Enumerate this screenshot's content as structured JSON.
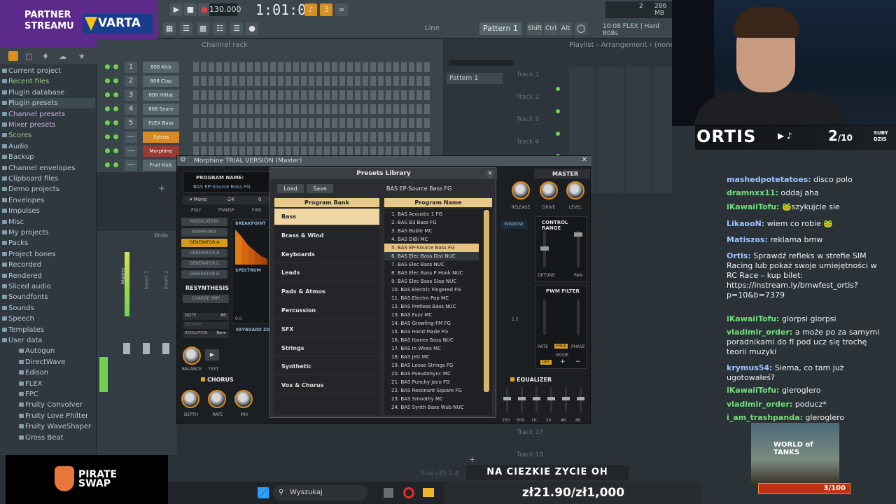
{
  "partner": {
    "line1": "PARTNER",
    "line2": "STREAMU",
    "brand": "VARTA"
  },
  "toolbar": {
    "tempo": "130.000",
    "time": "1:01:00",
    "line_mode": "Line",
    "pattern": "Pattern 1",
    "snap_keys": [
      "Shift",
      "Ctrl",
      "Alt"
    ],
    "hint": "10:08  FLEX | Hard 808s",
    "cpu": "286 MB",
    "cpu_n": "2"
  },
  "browser": {
    "items": [
      {
        "label": "Current project",
        "cls": ""
      },
      {
        "label": "Recent files",
        "cls": "green"
      },
      {
        "label": "Plugin database",
        "cls": ""
      },
      {
        "label": "Plugin presets",
        "cls": "hl"
      },
      {
        "label": "Channel presets",
        "cls": "purple"
      },
      {
        "label": "Mixer presets",
        "cls": "purple"
      },
      {
        "label": "Scores",
        "cls": "green"
      },
      {
        "label": "Audio",
        "cls": ""
      },
      {
        "label": "Backup",
        "cls": ""
      },
      {
        "label": "Channel envelopes",
        "cls": ""
      },
      {
        "label": "Clipboard files",
        "cls": ""
      },
      {
        "label": "Demo projects",
        "cls": ""
      },
      {
        "label": "Envelopes",
        "cls": ""
      },
      {
        "label": "Impulses",
        "cls": ""
      },
      {
        "label": "Misc",
        "cls": ""
      },
      {
        "label": "My projects",
        "cls": ""
      },
      {
        "label": "Packs",
        "cls": ""
      },
      {
        "label": "Project bones",
        "cls": ""
      },
      {
        "label": "Recorded",
        "cls": ""
      },
      {
        "label": "Rendered",
        "cls": ""
      },
      {
        "label": "Sliced audio",
        "cls": ""
      },
      {
        "label": "Soundfonts",
        "cls": ""
      },
      {
        "label": "Sounds",
        "cls": ""
      },
      {
        "label": "Speech",
        "cls": ""
      },
      {
        "label": "Templates",
        "cls": ""
      },
      {
        "label": "User data",
        "cls": ""
      },
      {
        "label": "Autogun",
        "cls": "sub"
      },
      {
        "label": "DirectWave",
        "cls": "sub"
      },
      {
        "label": "Edison",
        "cls": "sub"
      },
      {
        "label": "FLEX",
        "cls": "sub"
      },
      {
        "label": "FPC",
        "cls": "sub"
      },
      {
        "label": "Fruity Convolver",
        "cls": "sub"
      },
      {
        "label": "Fruity Love Philter",
        "cls": "sub"
      },
      {
        "label": "Fruity WaveShaper",
        "cls": "sub"
      },
      {
        "label": "Gross Beat",
        "cls": "sub"
      }
    ]
  },
  "channel_rack": {
    "title": "Channel rack",
    "channels": [
      {
        "num": "1",
        "name": "808 Kick",
        "cls": ""
      },
      {
        "num": "2",
        "name": "808 Clap",
        "cls": ""
      },
      {
        "num": "3",
        "name": "808 HiHat",
        "cls": ""
      },
      {
        "num": "4",
        "name": "808 Snare",
        "cls": ""
      },
      {
        "num": "5",
        "name": "FLEX Bass",
        "cls": ""
      },
      {
        "num": "---",
        "name": "Sytrus",
        "cls": "orange"
      },
      {
        "num": "---",
        "name": "Morphine",
        "cls": "red"
      },
      {
        "num": "---",
        "name": "Fruit Kick",
        "cls": ""
      }
    ]
  },
  "playlist": {
    "title": "Playlist - Arrangement › (none)",
    "pattern": "Pattern 1",
    "tracks": [
      "Track 1",
      "Track 2",
      "Track 3",
      "Track 4",
      "Track 17",
      "Track 18"
    ]
  },
  "mixer": {
    "wide": "Wide",
    "master": "Master",
    "insert1": "Insert 1",
    "insert2": "Insert 2"
  },
  "morphine": {
    "title": "Morphine TRIAL VERSION (Master)",
    "program_name_label": "PROGRAM NAME:",
    "program_name": "BAS EP-Source Bass FG",
    "mono": "Mono",
    "transp_val": "-24",
    "fine_val": "0",
    "poly": "POLY",
    "transp": "TRANSP",
    "fine": "FINE",
    "left_buttons": [
      "MODULATION",
      "MORPH/MIX",
      "GENERATOR A",
      "GENERATOR B",
      "GENERATOR C",
      "GENERATOR D"
    ],
    "breakpoint": "BREAKPOINT",
    "spectrum": "SPECTRUM",
    "keyboard_zone": "KEYBOARD ZO",
    "resynthesis": "RESYNTHESIS",
    "charge_smp": "CHARGE SMP",
    "note_lbl": "NOTE",
    "note_val": "60",
    "detune_lbl": "DETUNE",
    "resolution_lbl": "RESOLUTION",
    "resolution_val": "Norm",
    "balance": "BALANCE",
    "test": "TEST",
    "chorus": "CHORUS",
    "chorus_knobs": [
      "DEPTH",
      "RATE",
      "MIX"
    ],
    "master": "MASTER",
    "master_knobs": [
      "RELEASE",
      "DRIVE",
      "LEVEL"
    ],
    "control_range": "CONTROL RANGE",
    "detune_pan": [
      "DETUNE",
      "PAN"
    ],
    "pwm_filter": "PWM FILTER",
    "pwm_lbls": [
      "RATE",
      "FREE",
      "PHASE"
    ],
    "mode": "MODE",
    "mode_off": "OFF",
    "equalizer": "EQUALIZER",
    "eq_bands": [
      "250",
      "500",
      "1K",
      "2K",
      "4K",
      "8K"
    ],
    "window": "WINDOW",
    "val_00": "0.0",
    "val_15": "1.5"
  },
  "presets": {
    "title": "Presets Library",
    "load": "Load",
    "save": "Save",
    "current": "BAS EP-Source Bass FG",
    "bank_header": "Program Bank",
    "prog_header": "Program Name",
    "banks": [
      "Bass",
      "Brass & Wind",
      "Keyboards",
      "Leads",
      "Pads & Atmos",
      "Percussion",
      "SFX",
      "Strings",
      "Synthetic",
      "Vox & Chorus"
    ],
    "selected_bank": 0,
    "programs": [
      "1. BAS Acoustic 1 FG",
      "2. BAS B3 Bass FG",
      "3. BAS Buble MC",
      "4. BAS DiBi MC",
      "5. BAS EP-Source Bass FG",
      "6. BAS Elec Bass Dist NUC",
      "7. BAS Elec Bass NUC",
      "8. BAS Elec Bass P Hook NUC",
      "9. BAS Elec Bass Slap NUC",
      "10. BAS Electric Fingered FG",
      "11. BAS Electro Pop MC",
      "12. BAS Fretless Bass NUC",
      "13. BAS Fuzz MC",
      "14. BAS Growling-FM FG",
      "15. BAS Hand Made FG",
      "16. BAS Ibanez Bass NUC",
      "17. BAS In Wires MC",
      "18. BAS Jett MC",
      "19. BAS Loose Strings FG",
      "20. BAS PseudoSync MC",
      "21. BAS Punchy Jaco FG",
      "22. BAS Resonant Square FG",
      "23. BAS Smoothy MC",
      "24. BAS Synth Bass Wub NUC"
    ],
    "selected_program": 4,
    "hover_program": 5
  },
  "stream": {
    "name": "ORTIS",
    "sub_count": "2",
    "sub_goal": "/10",
    "sub_label1": "SUBY",
    "sub_label2": "DZIS",
    "social": "▶ ♪",
    "chat": [
      {
        "user": "mashedpotetatoes:",
        "text": "disco polo",
        "c": "b"
      },
      {
        "user": "dramnxx11:",
        "text": "oddaj aha",
        "c": "g"
      },
      {
        "user": "iKawaiiTofu:",
        "text": "🐸szykujcie sie",
        "c": "g"
      },
      {
        "user": "LikaooN:",
        "text": "wiem co robie 🐸",
        "c": "b"
      },
      {
        "user": "Matiszos:",
        "text": "reklama bmw",
        "c": "b"
      },
      {
        "user": "Ortis:",
        "text": "Sprawdź refleks w strefie SIM Racing lub pokaż swoje umiejętności w RC Race – kup bilet: https://instream.ly/bmwfest_ortis?p=10&b=7379",
        "c": "b"
      },
      {
        "user": "iKawaiiTofu:",
        "text": "glorpsi glorpsi",
        "c": "g"
      },
      {
        "user": "vladimir_order:",
        "text": "a może po za samymi poradnikami do fl pod ucz się trochę teorii muzyki",
        "c": "g"
      },
      {
        "user": "krymus54:",
        "text": "Siema, co tam już ugotowałeś?",
        "c": "b"
      },
      {
        "user": "iKawaiiTofu:",
        "text": "gleroglero",
        "c": "g"
      },
      {
        "user": "vladimir_order:",
        "text": "poducz*",
        "c": "g"
      },
      {
        "user": "i_am_trashpanda:",
        "text": "gleroglero",
        "c": "g"
      }
    ],
    "wot_title": "WORLD of TANKS",
    "wot_progress": "3/100",
    "pirate": [
      "PIRATE",
      "SWAP"
    ],
    "banner1": "NA CIEZKIE ZYCIE OH",
    "banner2": "zł21.90/zł1,000",
    "trial": "Trial v25.1.4"
  },
  "taskbar": {
    "search": "Wyszukaj"
  }
}
